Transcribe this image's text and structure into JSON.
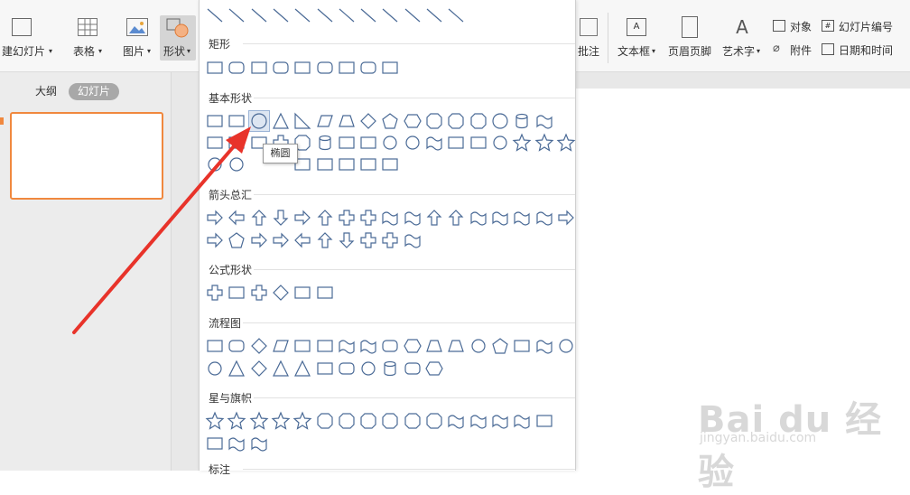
{
  "ribbon": {
    "new_slide": "建幻灯片",
    "table": "表格",
    "picture": "图片",
    "shape": "形状",
    "comment": "批注",
    "textbox": "文本框",
    "header_footer": "页眉页脚",
    "wordart": "艺术字",
    "object": "对象",
    "slide_number": "幻灯片编号",
    "attachment": "附件",
    "datetime": "日期和时间"
  },
  "sidebar": {
    "tab_outline": "大纲",
    "tab_slides": "幻灯片"
  },
  "shapes_panel": {
    "sections": {
      "rect": "矩形",
      "basic": "基本形状",
      "arrows": "箭头总汇",
      "formula": "公式形状",
      "flowchart": "流程图",
      "stars": "星与旗帜",
      "callouts": "标注"
    },
    "tooltip": "椭圆",
    "highlighted": "ellipse"
  },
  "watermark": {
    "brand": "Bai du 经验",
    "url": "jingyan.baidu.com"
  },
  "colors": {
    "accent": "#f0883e",
    "shape_stroke": "#4a6a96",
    "annotation_arrow": "#e8332a"
  }
}
